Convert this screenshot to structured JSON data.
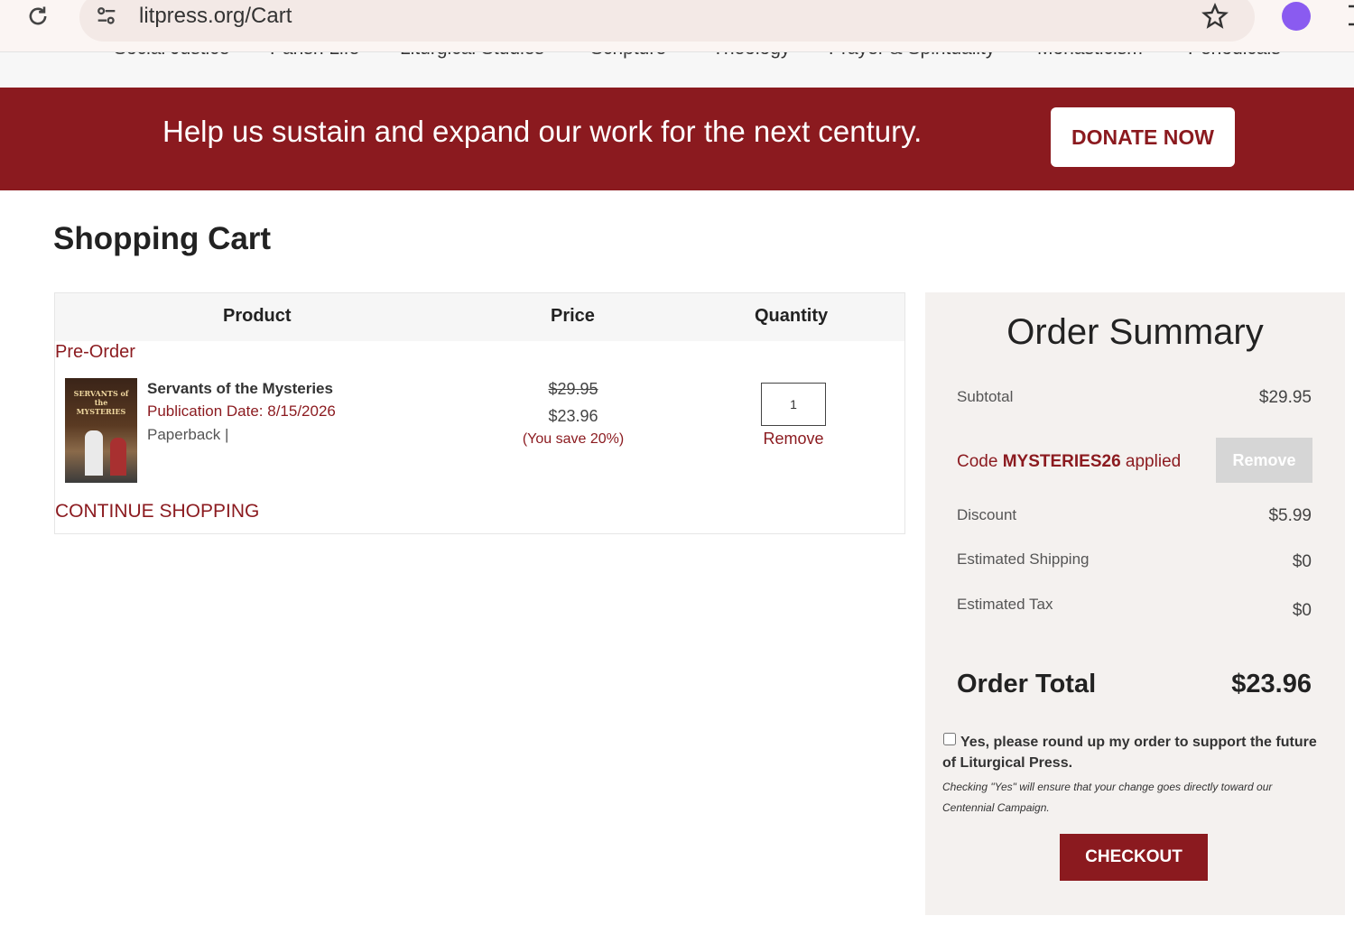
{
  "browser": {
    "url": "litpress.org/Cart",
    "icons": {
      "reload": "reload-icon",
      "site_settings": "tune-icon",
      "bookmark": "star-icon",
      "extension": "extension-icon"
    }
  },
  "category_nav": [
    "Social Justice",
    "Parish Life",
    "Liturgical Studies",
    "Scripture",
    "Theology",
    "Prayer & Spirituality",
    "Monasticism",
    "Periodicals"
  ],
  "banner": {
    "text": "Help us sustain and expand our work for the next century.",
    "button": "DONATE NOW",
    "color": "#8b1a1f"
  },
  "page_title": "Shopping Cart",
  "cart": {
    "headers": {
      "product": "Product",
      "price": "Price",
      "quantity": "Quantity"
    },
    "section_label": "Pre-Order",
    "item": {
      "cover_text": "SERVANTS of the MYSTERIES",
      "name": "Servants of the Mysteries",
      "publication_date": "Publication Date: 8/15/2026",
      "format": "Paperback |",
      "price_original": "$29.95",
      "price_sale": "$23.96",
      "savings": "(You save 20%)",
      "quantity": "1",
      "remove": "Remove"
    },
    "continue": "CONTINUE SHOPPING"
  },
  "summary": {
    "title": "Order Summary",
    "subtotal_label": "Subtotal",
    "subtotal": "$29.95",
    "code_prefix": "Code ",
    "code": "MYSTERIES26",
    "code_suffix": " applied",
    "code_remove": "Remove",
    "discount_label": "Discount",
    "discount": "$5.99",
    "shipping_label": "Estimated Shipping",
    "shipping": "$0",
    "tax_label": "Estimated Tax",
    "tax": "$0",
    "total_label": "Order Total",
    "total": "$23.96",
    "roundup": "Yes, please round up my order to support the future of Liturgical Press.",
    "roundup_note": "Checking \"Yes\" will ensure that your change goes directly toward our Centennial Campaign.",
    "checkout": "CHECKOUT"
  }
}
